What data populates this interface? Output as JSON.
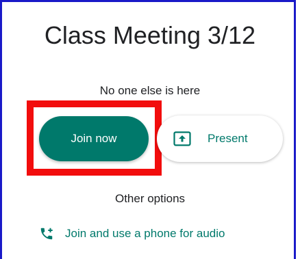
{
  "meeting": {
    "title": "Class Meeting 3/12",
    "status": "No one else is here"
  },
  "actions": {
    "join_label": "Join now",
    "present_label": "Present"
  },
  "other_options": {
    "heading": "Other options",
    "phone_audio_label": "Join and use a phone for audio"
  },
  "icons": {
    "present": "present-screen-icon",
    "phone": "add-call-icon"
  },
  "colors": {
    "accent": "#00796b",
    "highlight": "#f20d0d",
    "frame": "#1a1ac8",
    "text": "#202124"
  }
}
